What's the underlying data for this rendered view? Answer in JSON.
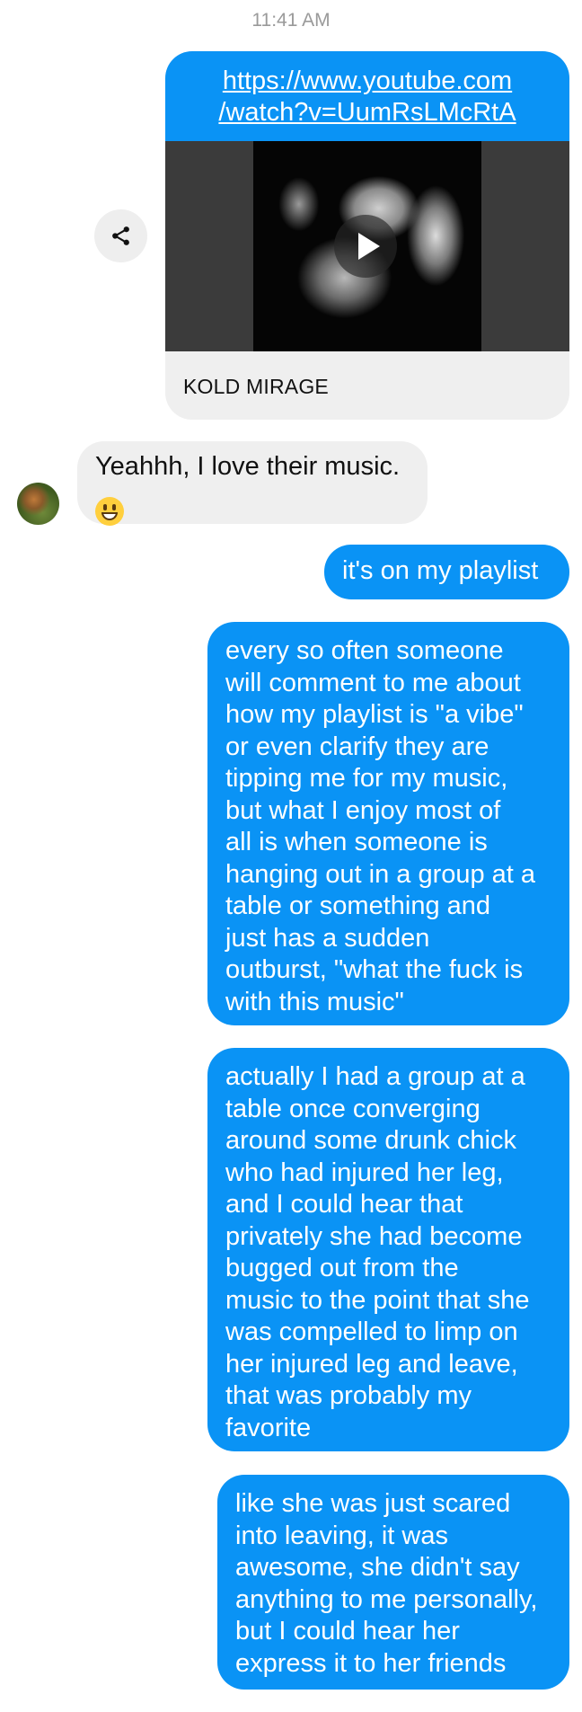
{
  "conversation": {
    "timestamp": "11:41 AM",
    "shared_link": {
      "url_line1": "https://www.youtube.com",
      "url_line2": "/watch?v=UumRsLMcRtA",
      "title": "KOLD MIRAGE",
      "share_icon": "share-icon",
      "play_icon": "play-icon"
    },
    "messages": [
      {
        "sender": "them",
        "text": "Yeahhh, I love their music.",
        "emoji": "grinning-face-emoji"
      },
      {
        "sender": "me",
        "text": "it's on my playlist"
      },
      {
        "sender": "me",
        "lines": [
          "every so often someone",
          "will comment to me about",
          "how my playlist is \"a vibe\"",
          "or even clarify they are",
          "tipping me for my music,",
          "but what I enjoy most of",
          "all is when someone is",
          "hanging out in a group at a",
          "table or something and",
          "just has a sudden",
          "outburst, \"what the fuck is",
          "with this music\""
        ]
      },
      {
        "sender": "me",
        "lines": [
          "actually I had a group at a",
          "table once converging",
          "around some drunk chick",
          "who had injured her leg,",
          "and I could hear that",
          "privately she had become",
          "bugged out from the",
          "music to the point that she",
          "was compelled to limp on",
          "her injured leg and leave,",
          "that was probably my",
          "favorite"
        ]
      },
      {
        "sender": "me",
        "lines": [
          "like she was just scared",
          "into leaving, it was",
          "awesome, she didn't say",
          "anything to me personally,",
          "but I could hear her",
          "express it to her friends"
        ]
      }
    ],
    "colors": {
      "outgoing_bubble": "#0a93f5",
      "incoming_bubble": "#efefef",
      "timestamp_text": "#9a9a9a"
    }
  }
}
